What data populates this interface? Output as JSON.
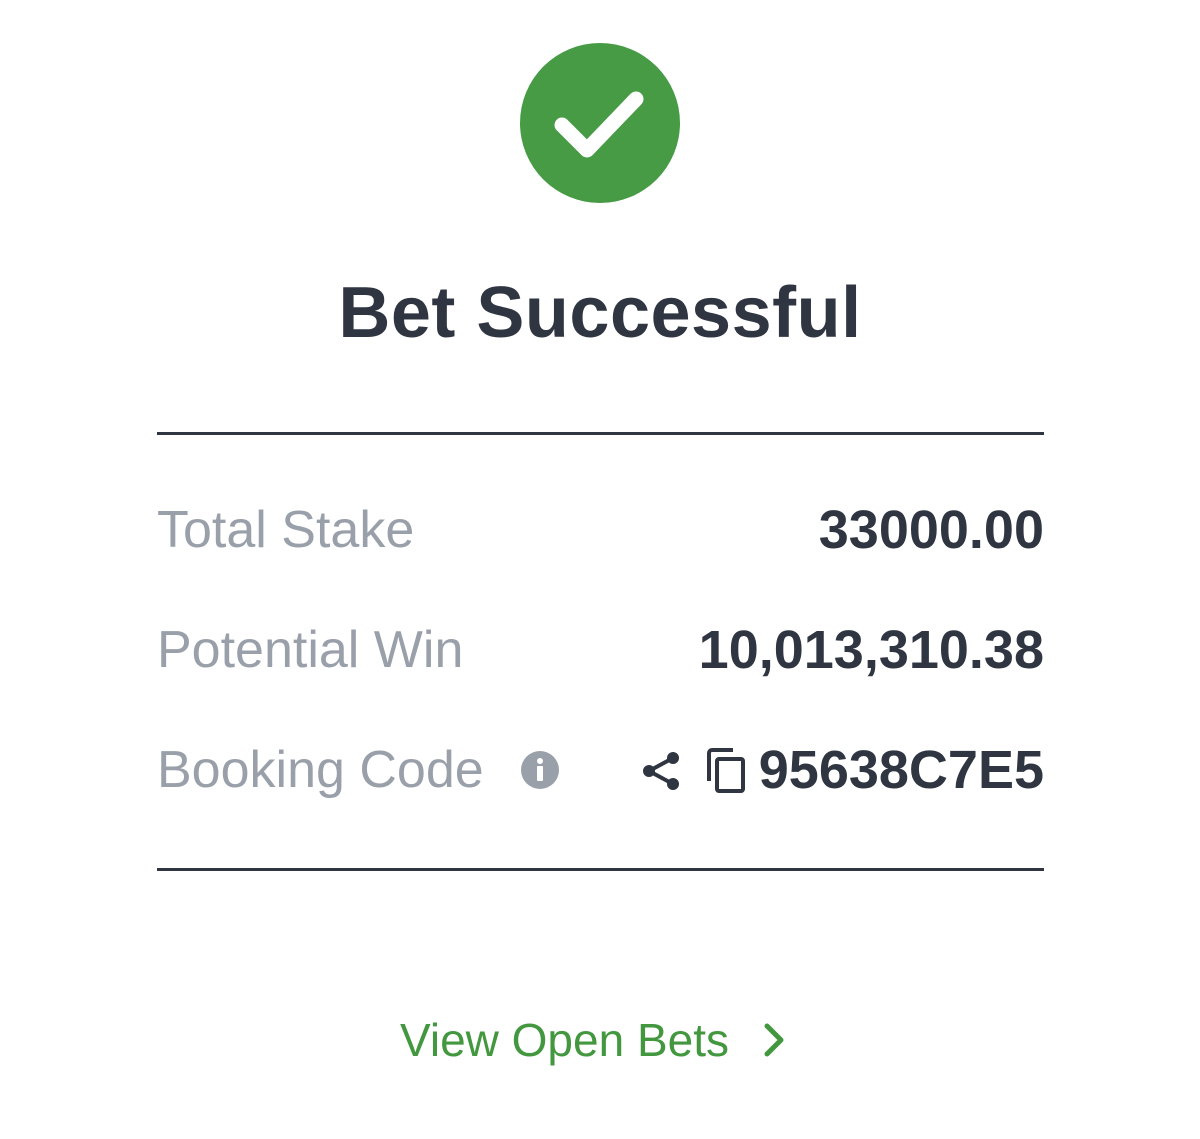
{
  "header": {
    "title": "Bet Successful",
    "status_icon": "check-circle-icon",
    "status_color": "#469b44"
  },
  "summary": {
    "total_stake": {
      "label": "Total Stake",
      "value": "33000.00"
    },
    "potential_win": {
      "label": "Potential Win",
      "value": "10,013,310.38"
    },
    "booking_code": {
      "label": "Booking Code",
      "value": "95638C7E5",
      "info_icon": "info-icon",
      "share_icon": "share-icon",
      "copy_icon": "copy-icon"
    }
  },
  "actions": {
    "view_open_bets_label": "View Open Bets",
    "view_open_bets_icon": "chevron-right-icon",
    "link_color": "#43973f"
  },
  "colors": {
    "text_dark": "#2f3541",
    "text_muted": "#9aa0aa",
    "divider": "#2f3541"
  }
}
